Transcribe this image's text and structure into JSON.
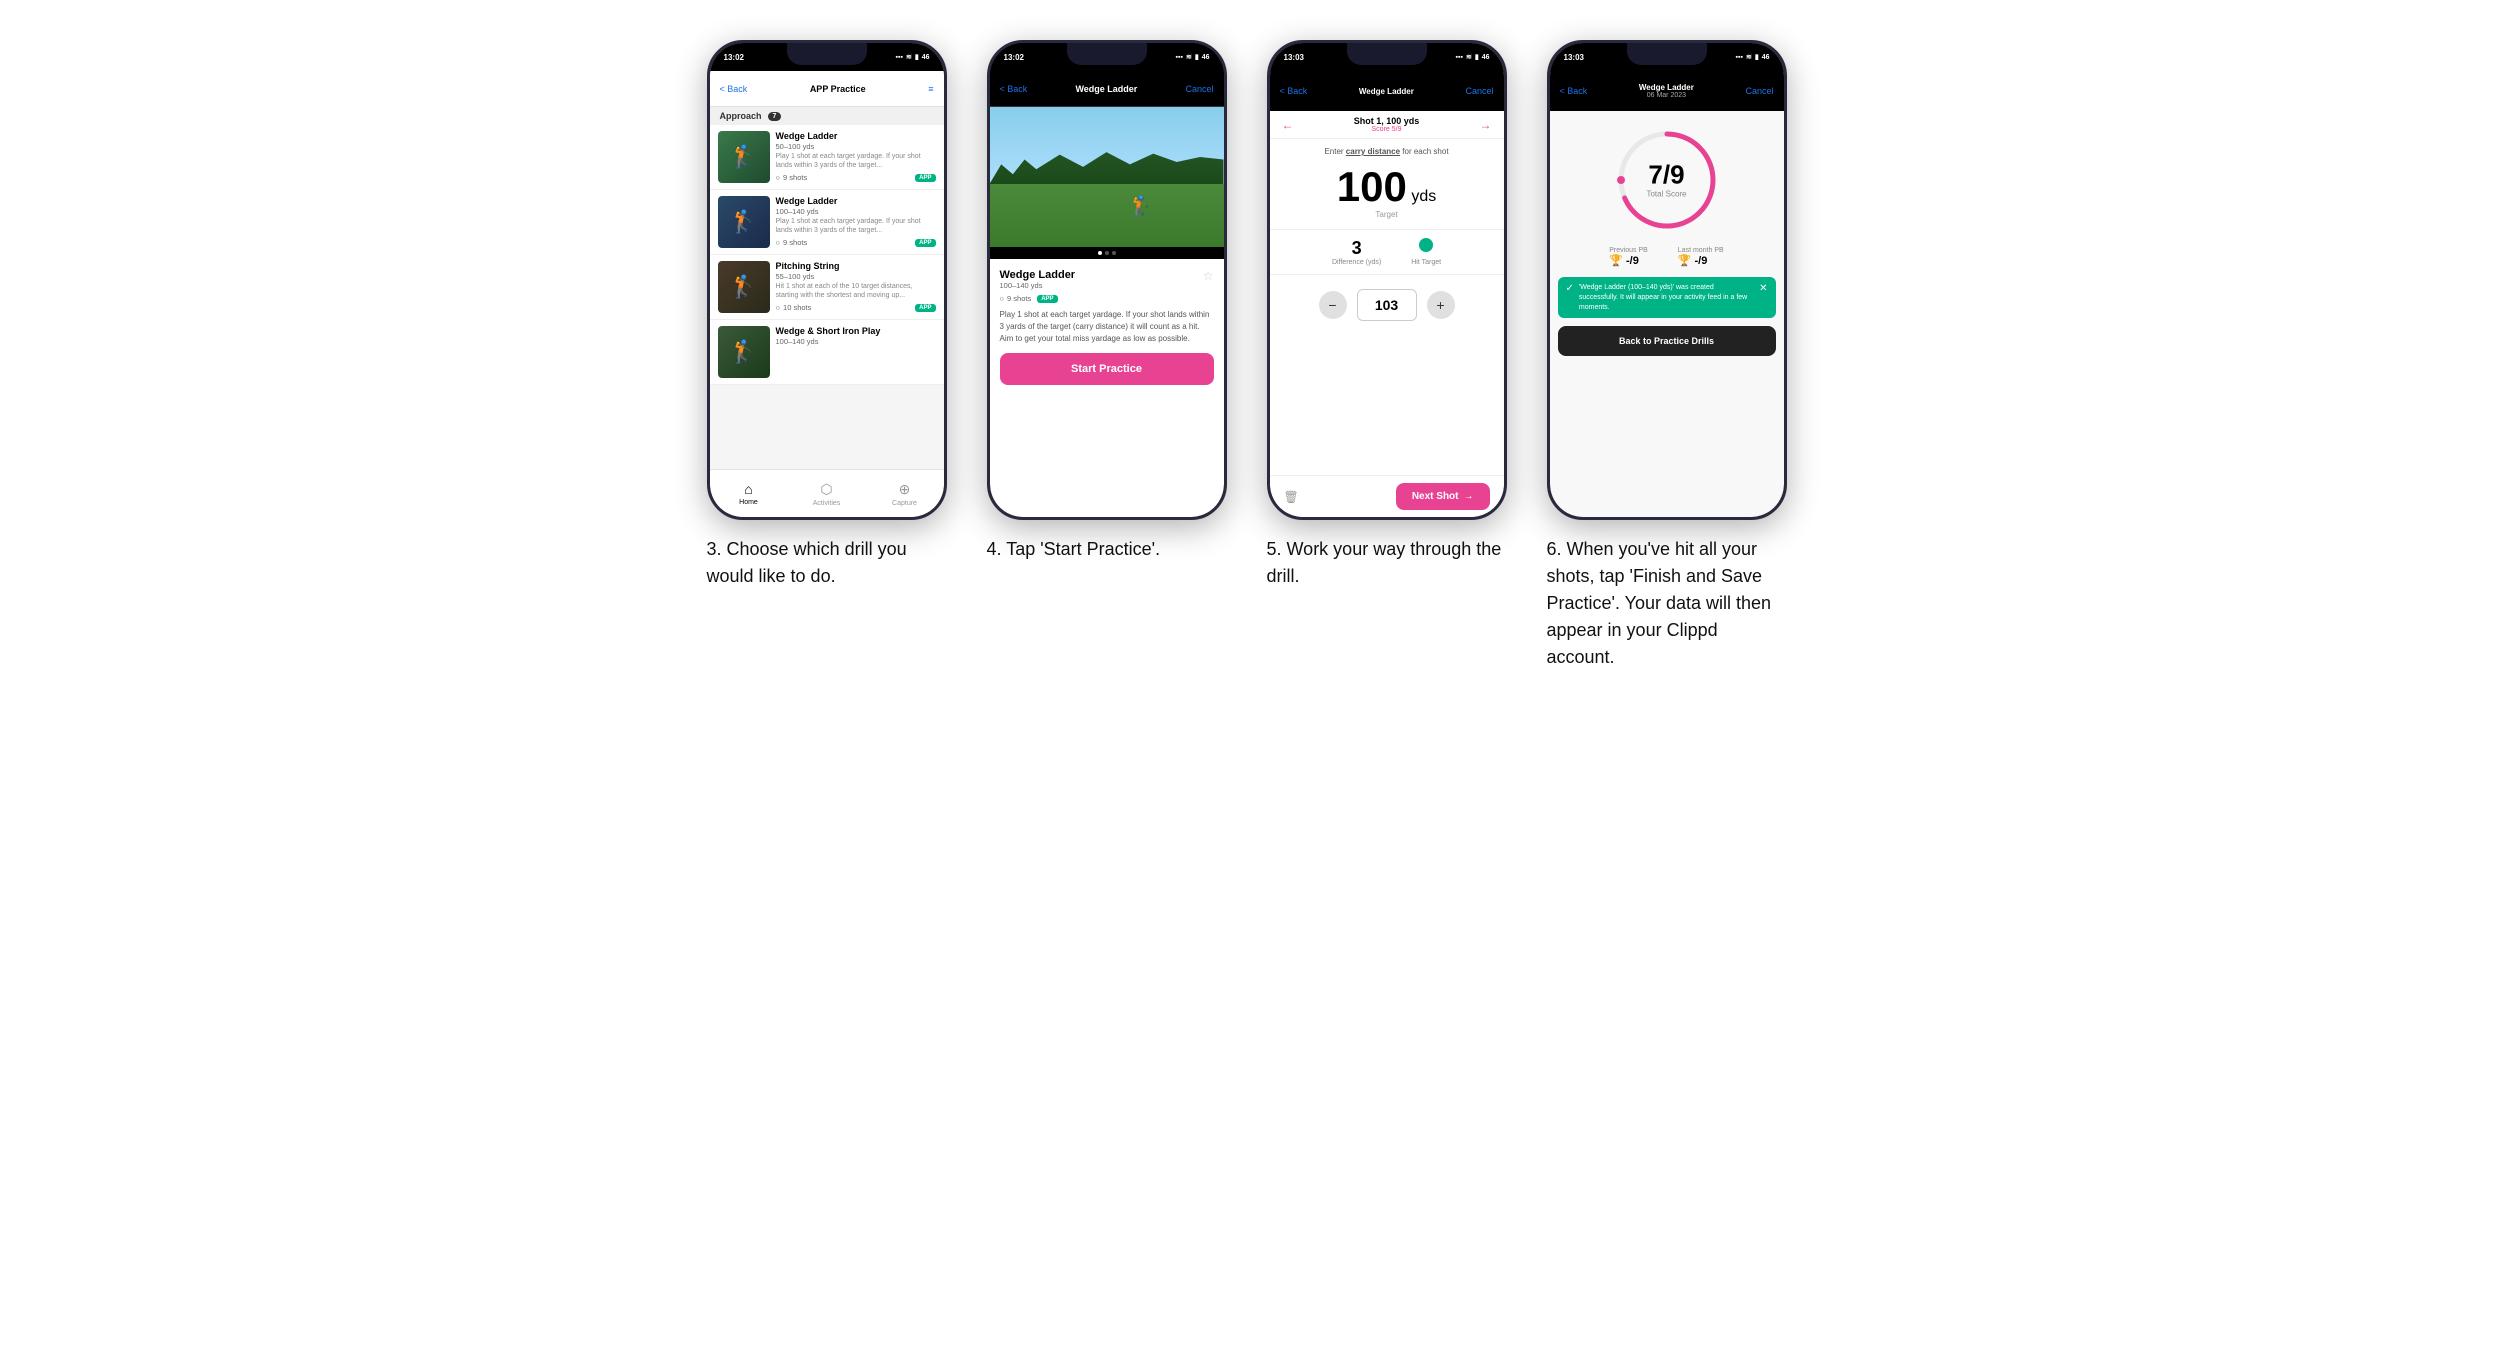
{
  "phones": [
    {
      "id": "phone1",
      "status_time": "13:02",
      "nav": {
        "back": "< Back",
        "title": "APP Practice",
        "right": "≡"
      },
      "section": "Approach",
      "section_count": "7",
      "drills": [
        {
          "name": "Wedge Ladder",
          "yds": "50–100 yds",
          "desc": "Play 1 shot at each target yardage. If your shot lands within 3 yards of the target...",
          "shots": "9 shots",
          "badge": "APP"
        },
        {
          "name": "Wedge Ladder",
          "yds": "100–140 yds",
          "desc": "Play 1 shot at each target yardage. If your shot lands within 3 yards of the target...",
          "shots": "9 shots",
          "badge": "APP"
        },
        {
          "name": "Pitching String",
          "yds": "55–100 yds",
          "desc": "Hit 1 shot at each of the 10 target distances, starting with the shortest and moving up...",
          "shots": "10 shots",
          "badge": "APP"
        },
        {
          "name": "Wedge & Short Iron Play",
          "yds": "100–140 yds",
          "desc": "",
          "shots": "",
          "badge": ""
        }
      ],
      "tabs": [
        "Home",
        "Activities",
        "Capture"
      ]
    },
    {
      "id": "phone2",
      "status_time": "13:02",
      "nav": {
        "back": "< Back",
        "title": "Wedge Ladder",
        "right": "Cancel"
      },
      "drill": {
        "name": "Wedge Ladder",
        "yds": "100–140 yds",
        "shots": "9 shots",
        "badge": "APP",
        "desc": "Play 1 shot at each target yardage. If your shot lands within 3 yards of the target (carry distance) it will count as a hit. Aim to get your total miss yardage as low as possible."
      },
      "start_btn": "Start Practice"
    },
    {
      "id": "phone3",
      "status_time": "13:03",
      "nav": {
        "back": "< Back",
        "title_line1": "Wedge Ladder",
        "title_line2": "Score 5/9",
        "right": "Cancel"
      },
      "shot_nav": {
        "shot_label": "Shot 1, 100 yds",
        "score_label": "Score 5/9"
      },
      "carry_instruction": "Enter carry distance for each shot",
      "target_yds": "100",
      "target_unit": "yds",
      "target_label": "Target",
      "difference": "3",
      "difference_label": "Difference (yds)",
      "hit_target_label": "Hit Target",
      "input_value": "103",
      "next_shot": "Next Shot"
    },
    {
      "id": "phone4",
      "status_time": "13:03",
      "nav": {
        "back": "< Back",
        "title_line1": "Wedge Ladder",
        "title_line2": "06 Mar 2023",
        "right": "Cancel"
      },
      "score": "7/9",
      "score_label": "Total Score",
      "prev_pb_label": "Previous PB",
      "prev_pb": "-/9",
      "last_pb_label": "Last month PB",
      "last_pb": "-/9",
      "toast_text": "'Wedge Ladder (100–140 yds)' was created successfully. It will appear in your activity feed in a few moments.",
      "back_btn": "Back to Practice Drills"
    }
  ],
  "captions": [
    "3. Choose which drill you would like to do.",
    "4. Tap 'Start Practice'.",
    "5. Work your way through the drill.",
    "6. When you've hit all your shots, tap 'Finish and Save Practice'. Your data will then appear in your Clippd account."
  ]
}
